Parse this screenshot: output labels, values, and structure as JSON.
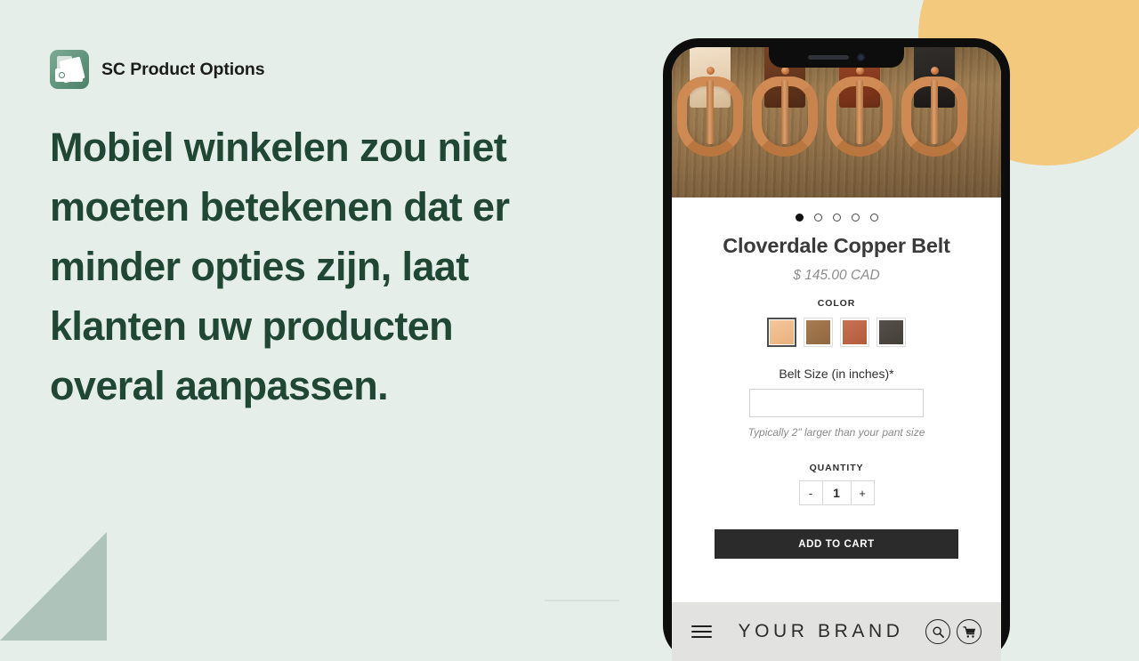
{
  "theme": {
    "background": "#e6eeea",
    "headline_color": "#204734",
    "accent_circle": "#f2c97d",
    "accent_triangle": "#aec4bb"
  },
  "brand": {
    "logo_icon": "product-options-logo-icon",
    "name": "SC Product Options"
  },
  "headline": "Mobiel winkelen zou niet moeten betekenen dat er minder opties zijn, laat klanten uw producten overal aanpassen.",
  "phone": {
    "notch": {
      "speaker_icon": "speaker-slot-icon",
      "camera_icon": "front-camera-icon"
    },
    "product": {
      "photo_alt": "copper-belt-buckles-photo",
      "carousel": {
        "total": 5,
        "active_index": 0
      },
      "title": "Cloverdale Copper Belt",
      "price": "$ 145.00 CAD",
      "color": {
        "label": "COLOR",
        "swatches": [
          {
            "name": "natural-tan",
            "hex": "#edb887",
            "selected": true
          },
          {
            "name": "medium-brown",
            "hex": "#9d7248",
            "selected": false
          },
          {
            "name": "rust-copper",
            "hex": "#bf6745",
            "selected": false
          },
          {
            "name": "dark-charcoal",
            "hex": "#4d4741",
            "selected": false
          }
        ]
      },
      "size": {
        "label": "Belt Size (in inches)*",
        "value": "",
        "placeholder": "",
        "hint": "Typically 2\" larger than your pant size"
      },
      "quantity": {
        "label": "QUANTITY",
        "decrement": "-",
        "value": "1",
        "increment": "+"
      },
      "add_to_cart": "ADD TO CART"
    },
    "bottom_bar": {
      "menu_icon": "hamburger-menu-icon",
      "wordmark": "YOUR BRAND",
      "search_icon": "search-icon",
      "cart_icon": "shopping-cart-icon"
    }
  }
}
